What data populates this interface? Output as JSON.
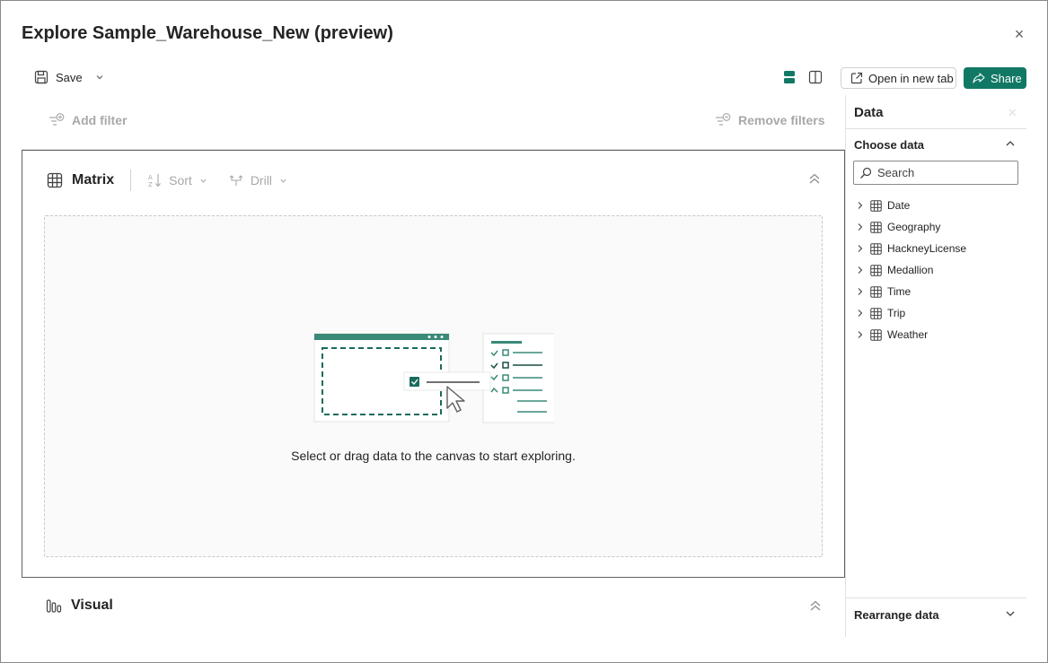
{
  "dialog": {
    "title": "Explore Sample_Warehouse_New (preview)",
    "close_glyph": "×"
  },
  "toolbar": {
    "save_label": "Save",
    "open_new_tab_label": "Open in new tab",
    "share_label": "Share"
  },
  "filters": {
    "add_label": "Add filter",
    "remove_label": "Remove filters"
  },
  "matrix": {
    "title": "Matrix",
    "sort_label": "Sort",
    "drill_label": "Drill",
    "empty_message": "Select or drag data to the canvas to start exploring."
  },
  "visual": {
    "title": "Visual"
  },
  "data_pane": {
    "title": "Data",
    "choose_label": "Choose data",
    "search_placeholder": "Search",
    "tables": [
      {
        "label": "Date"
      },
      {
        "label": "Geography"
      },
      {
        "label": "HackneyLicense"
      },
      {
        "label": "Medallion"
      },
      {
        "label": "Time"
      },
      {
        "label": "Trip"
      },
      {
        "label": "Weather"
      }
    ],
    "rearrange_label": "Rearrange data"
  },
  "colors": {
    "accent": "#117865",
    "disabled_text": "#a8a8a8",
    "border": "#e0e0e0"
  }
}
